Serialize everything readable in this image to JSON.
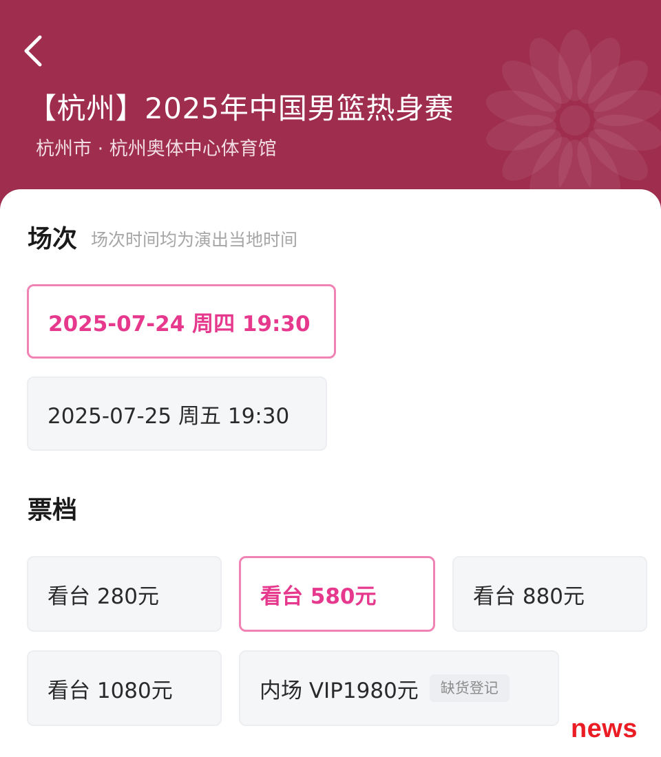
{
  "header": {
    "back_icon": "chevron-left-icon",
    "title": "【杭州】2025年中国男篮热身赛",
    "venue": "杭州市 · 杭州奥体中心体育馆",
    "background_color": "#9e2d4e"
  },
  "sessions": {
    "title": "场次",
    "hint": "场次时间均为演出当地时间",
    "items": [
      {
        "label": "2025-07-24 周四 19:30",
        "selected": true
      },
      {
        "label": "2025-07-25 周五 19:30",
        "selected": false
      }
    ]
  },
  "tickets": {
    "title": "票档",
    "items": [
      {
        "label": "看台 280元",
        "selected": false
      },
      {
        "label": "看台 580元",
        "selected": true
      },
      {
        "label": "看台 880元",
        "selected": false
      },
      {
        "label": "看台 1080元",
        "selected": false
      },
      {
        "label": "内场 VIP1980元",
        "selected": false,
        "badge": "缺货登记"
      }
    ]
  },
  "watermark": {
    "text": "news"
  },
  "colors": {
    "accent": "#e6398d",
    "accent_border": "#f082b4",
    "chip_background": "#f5f6f8"
  }
}
